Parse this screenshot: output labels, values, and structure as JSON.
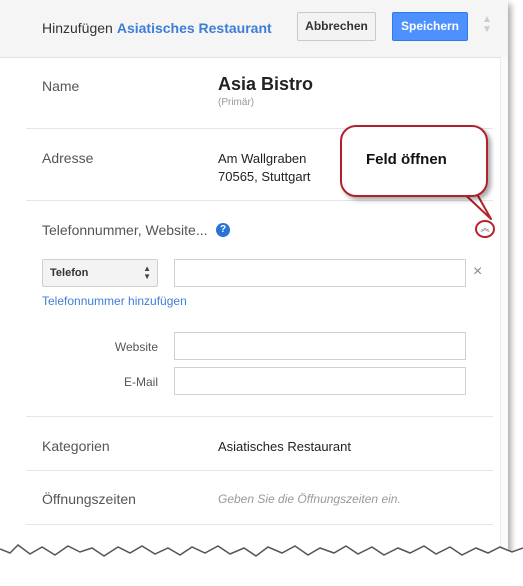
{
  "header": {
    "prefix": "Hinzufügen",
    "business_type": "Asiatisches Restaurant",
    "cancel_label": "Abbrechen",
    "save_label": "Speichern"
  },
  "name_section": {
    "label": "Name",
    "value": "Asia Bistro",
    "sub": "(Primär)"
  },
  "address_section": {
    "label": "Adresse",
    "line1": "Am Wallgraben",
    "line2": "70565, Stuttgart"
  },
  "contact_section": {
    "label": "Telefonnummer, Website...",
    "help_glyph": "?",
    "phone_type": "Telefon",
    "add_phone_link": "Telefonnummer hinzufügen",
    "website_label": "Website",
    "email_label": "E-Mail",
    "clear_glyph": "×"
  },
  "categories_section": {
    "label": "Kategorien",
    "value": "Asiatisches Restaurant"
  },
  "hours_section": {
    "label": "Öffnungszeiten",
    "placeholder": "Geben Sie die Öffnungszeiten ein."
  },
  "callout": {
    "text": "Feld öffnen"
  },
  "icons": {
    "header_scroll": "up-down-arrows-icon",
    "select": "up-down-arrows-icon",
    "collapse": "double-chevron-up-icon",
    "clear": "close-icon",
    "help": "help-icon"
  },
  "colors": {
    "accent_blue": "#3d7ed6",
    "save_button": "#4d90fe",
    "callout_border": "#b22029"
  }
}
